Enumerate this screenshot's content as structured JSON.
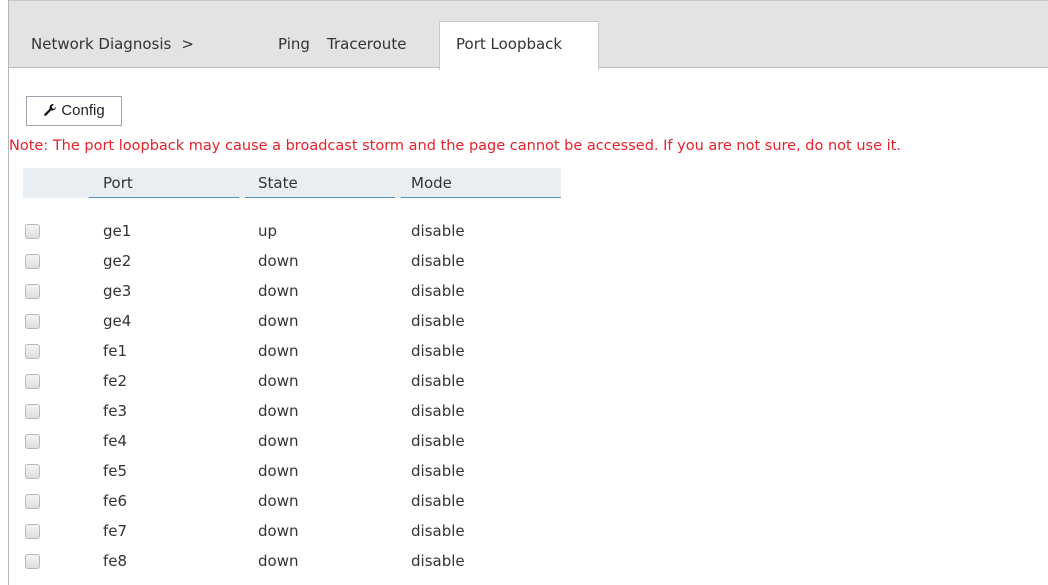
{
  "breadcrumb": {
    "label": "Network Diagnosis",
    "separator": ">"
  },
  "tabs": [
    {
      "label": "Ping"
    },
    {
      "label": "Traceroute"
    },
    {
      "label": "Port Loopback",
      "active": true
    }
  ],
  "toolbar": {
    "config_label": "Config",
    "config_icon": "wrench-icon"
  },
  "note": "Note: The port loopback may cause a broadcast storm and the page cannot be accessed. If you are not sure, do not use it.",
  "table": {
    "headers": {
      "port": "Port",
      "state": "State",
      "mode": "Mode"
    },
    "rows": [
      {
        "port": "ge1",
        "state": "up",
        "mode": "disable"
      },
      {
        "port": "ge2",
        "state": "down",
        "mode": "disable"
      },
      {
        "port": "ge3",
        "state": "down",
        "mode": "disable"
      },
      {
        "port": "ge4",
        "state": "down",
        "mode": "disable"
      },
      {
        "port": "fe1",
        "state": "down",
        "mode": "disable"
      },
      {
        "port": "fe2",
        "state": "down",
        "mode": "disable"
      },
      {
        "port": "fe3",
        "state": "down",
        "mode": "disable"
      },
      {
        "port": "fe4",
        "state": "down",
        "mode": "disable"
      },
      {
        "port": "fe5",
        "state": "down",
        "mode": "disable"
      },
      {
        "port": "fe6",
        "state": "down",
        "mode": "disable"
      },
      {
        "port": "fe7",
        "state": "down",
        "mode": "disable"
      },
      {
        "port": "fe8",
        "state": "down",
        "mode": "disable"
      }
    ]
  },
  "colors": {
    "note_text": "#e8202a",
    "header_underline": "#5a8fc4",
    "tabbar_bg": "#e3e3e3"
  }
}
